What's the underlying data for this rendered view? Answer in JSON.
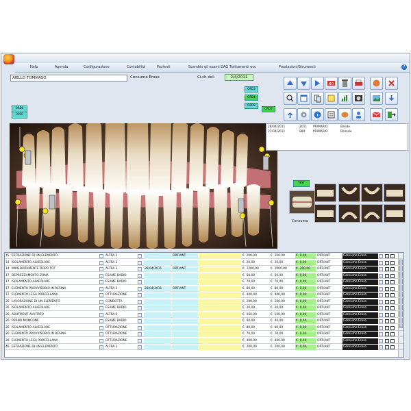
{
  "menu": {
    "items": [
      "Help",
      "Agenda",
      "Configurazione",
      "Contabilità",
      "Pazienti",
      "Scambio gli esami DAG Trattamenti ecc",
      "Prestazioni/Strumenti"
    ]
  },
  "header": {
    "patient_name": "AIELLO TOMMASO",
    "treatment_label": "Consumo Eroso",
    "date_label": "Ci.ch del:",
    "date_value": "2/4/2011"
  },
  "badges": {
    "left": [
      "ORD0",
      "0000"
    ],
    "right": [
      "ORD3",
      "ORD4",
      "ORD8",
      "ORD7"
    ],
    "thumb_label": "TEST"
  },
  "history": {
    "rows": [
      [
        "28/04/2011",
        "2011",
        "PRIMARIO",
        "Bande"
      ],
      [
        "21/04/2011",
        "889",
        "PRIMARIO",
        "Ebande"
      ]
    ]
  },
  "thumbnail_caption": "Consumo",
  "icons": [
    "arrow-up-icon",
    "arrow-down-icon",
    "next-icon",
    "ok-icon",
    "trash-icon",
    "print-icon",
    "tooth-icon",
    "close-icon",
    "search-icon",
    "calendar-icon",
    "copy-icon",
    "note-icon",
    "chart-icon",
    "xray-icon",
    "photo-icon",
    "import-icon",
    "export-icon",
    "settings-icon",
    "info-icon",
    "list-icon",
    "save-icon",
    "user-icon",
    "mail-icon",
    "exit-icon"
  ],
  "colors": {
    "green_cell": "#a6f28a",
    "cyan_cell": "#c8f2f7",
    "yellow_cell": "#fbf7a0",
    "dark_cell": "#1a1a1a"
  },
  "table": {
    "rows": [
      {
        "n": "15",
        "desc": "ESTRAZIONE DI UN ELEMENTO",
        "type": "ALTRA 1",
        "date": "",
        "code": "ORT/ANT",
        "price": "€. 200,00",
        "cost": "€. 200,00",
        "total": "€. 0,00",
        "status": "ORT/ANT",
        "op": "Consumo Eroso"
      },
      {
        "n": "14",
        "desc": "ISOLAMENTO ALVEOLARE",
        "type": "ALTRA 2",
        "date": "",
        "code": "",
        "price": "€. 20,00",
        "cost": "€. 20,00",
        "total": "€. 0,00",
        "status": "ORT/ANT",
        "op": "Consumo Eroso"
      },
      {
        "n": "14",
        "desc": "IMMEDIATAMENTE DOPO TOT",
        "type": "ALTRA 3",
        "date": "28/04/2011",
        "code": "ORT/ANT",
        "price": "€. 1200,00",
        "cost": "€. 1000,00",
        "total": "€. 200,00",
        "status": "ORT/ANT",
        "op": "Consumo Eroso"
      },
      {
        "n": "17",
        "desc": "DEPREZZAMENTO ZONA",
        "type": "ESAME RADIO",
        "date": "",
        "code": "",
        "price": "€. 50,00",
        "cost": "€. 50,00",
        "total": "€. 0,00",
        "status": "ORT/ANT",
        "op": "Consumo Eroso"
      },
      {
        "n": "17",
        "desc": "ISOLAMENTO ALVEOLARE",
        "type": "ESAME RADIO",
        "date": "",
        "code": "",
        "price": "€. 70,00",
        "cost": "€. 70,00",
        "total": "€. 0,00",
        "status": "ORT/ANT",
        "op": "Consumo Eroso"
      },
      {
        "n": "17",
        "desc": "ELEMENTO PROVVISORIO IN RESINA",
        "type": "ALTRA 1",
        "date": "28/04/2011",
        "code": "ORT/ANT",
        "price": "€. 80,00",
        "cost": "€. 80,00",
        "total": "€. 0,00",
        "status": "ORT/ANT",
        "op": "Consumo Eroso"
      },
      {
        "n": "17",
        "desc": "ELEMENTO LEGA PORCELLANA",
        "type": "OTTURAZIONE",
        "date": "",
        "code": "",
        "price": "€. 400,00",
        "cost": "€. 400,00",
        "total": "€. 0,00",
        "status": "ORT/ANT",
        "op": "Consumo Eroso"
      },
      {
        "n": "26",
        "desc": "LAVORAZIONE DI UN ELEMENTO",
        "type": "CONDOTTA",
        "date": "",
        "code": "",
        "price": "€. 200,00",
        "cost": "€. 200,00",
        "total": "€. 0,00",
        "status": "ORT/ANT",
        "op": "Consumo Eroso"
      },
      {
        "n": "26",
        "desc": "ISOLAMENTO ALVEOLARE",
        "type": "ESAME RADIO",
        "date": "",
        "code": "",
        "price": "€. 20,00",
        "cost": "€. 20,00",
        "total": "€. 0,00",
        "status": "ORT/ANT",
        "op": "Consumo Eroso"
      },
      {
        "n": "26",
        "desc": "ABUTMENT AVVITATO",
        "type": "ALTRA 2",
        "date": "",
        "code": "",
        "price": "€. 150,00",
        "cost": "€. 150,00",
        "total": "€. 0,00",
        "status": "ORT/ANT",
        "op": "Consumo Eroso"
      },
      {
        "n": "26",
        "desc": "PERNO MONCONE",
        "type": "ESAME RADIO",
        "date": "",
        "code": "",
        "price": "€. 40,00",
        "cost": "€. 40,00",
        "total": "€. 0,00",
        "status": "ORT/ANT",
        "op": "Consumo Eroso"
      },
      {
        "n": "26",
        "desc": "ISOLAMENTO ALVEOLARE",
        "type": "OTTURAZIONE",
        "date": "",
        "code": "",
        "price": "€. 80,00",
        "cost": "€. 80,00",
        "total": "€. 0,00",
        "status": "ORT/ANT",
        "op": "Consumo Eroso"
      },
      {
        "n": "26",
        "desc": "ELEMENTO PROVVISORIO IN RESINA",
        "type": "OTTURAZIONE",
        "date": "",
        "code": "",
        "price": "€. 70,00",
        "cost": "€. 70,00",
        "total": "€. 0,00",
        "status": "ORT/ANT",
        "op": "Consumo Eroso"
      },
      {
        "n": "26",
        "desc": "ELEMENTO LEGA PORCELLANA",
        "type": "OTTURAZIONE",
        "date": "",
        "code": "",
        "price": "€. 400,00",
        "cost": "€. 400,00",
        "total": "€. 0,00",
        "status": "ORT/ANT",
        "op": "Consumo Eroso"
      },
      {
        "n": "46",
        "desc": "ESTRAZIONE DI UN ELEMENTO",
        "type": "ALTRA 1",
        "date": "",
        "code": "",
        "price": "€. 200,00",
        "cost": "€. 200,00",
        "total": "€. 0,00",
        "status": "ORT/ANT",
        "op": "Consumo Eroso"
      }
    ]
  }
}
